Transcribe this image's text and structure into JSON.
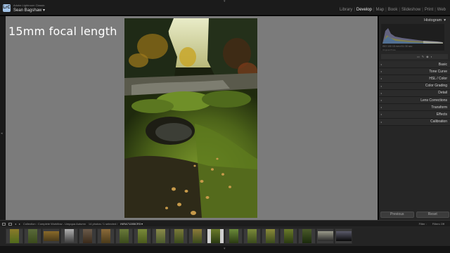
{
  "app": {
    "logo_text": "LrC",
    "app_name": "Adobe Lightroom Classic",
    "user_name": "Sean Bagshaw  ▾"
  },
  "modules": [
    "Library",
    "Develop",
    "Map",
    "Book",
    "Slideshow",
    "Print",
    "Web"
  ],
  "active_module": "Develop",
  "overlay_text": "15mm focal length",
  "right_panel": {
    "histogram_label": "Histogram",
    "histogram_info": "ISO 100   15 mm   f/11   30 sec",
    "histogram_foot": "Original Photo",
    "sections": [
      {
        "label": "Basic"
      },
      {
        "label": "Tone Curve"
      },
      {
        "label": "HSL / Color"
      },
      {
        "label": "Color Grading"
      },
      {
        "label": "Detail"
      },
      {
        "label": "Lens Corrections"
      },
      {
        "label": "Transform"
      },
      {
        "label": "Effects"
      },
      {
        "label": "Calibration"
      }
    ],
    "previous_label": "Previous",
    "reset_label": "Reset"
  },
  "filmstrip_header": {
    "collection": "Collection : Complete Workflow - Umpqua Autumn",
    "count": "14 photos / 1 selected /",
    "filename": "INRA71285CR3 ▾",
    "filter_label": "Filter :",
    "filter_value": "Filters Off"
  },
  "colors": {
    "canvas_bg": "#7b7b7b",
    "panel_bg": "#262626",
    "active_module": "#eeeeee"
  }
}
